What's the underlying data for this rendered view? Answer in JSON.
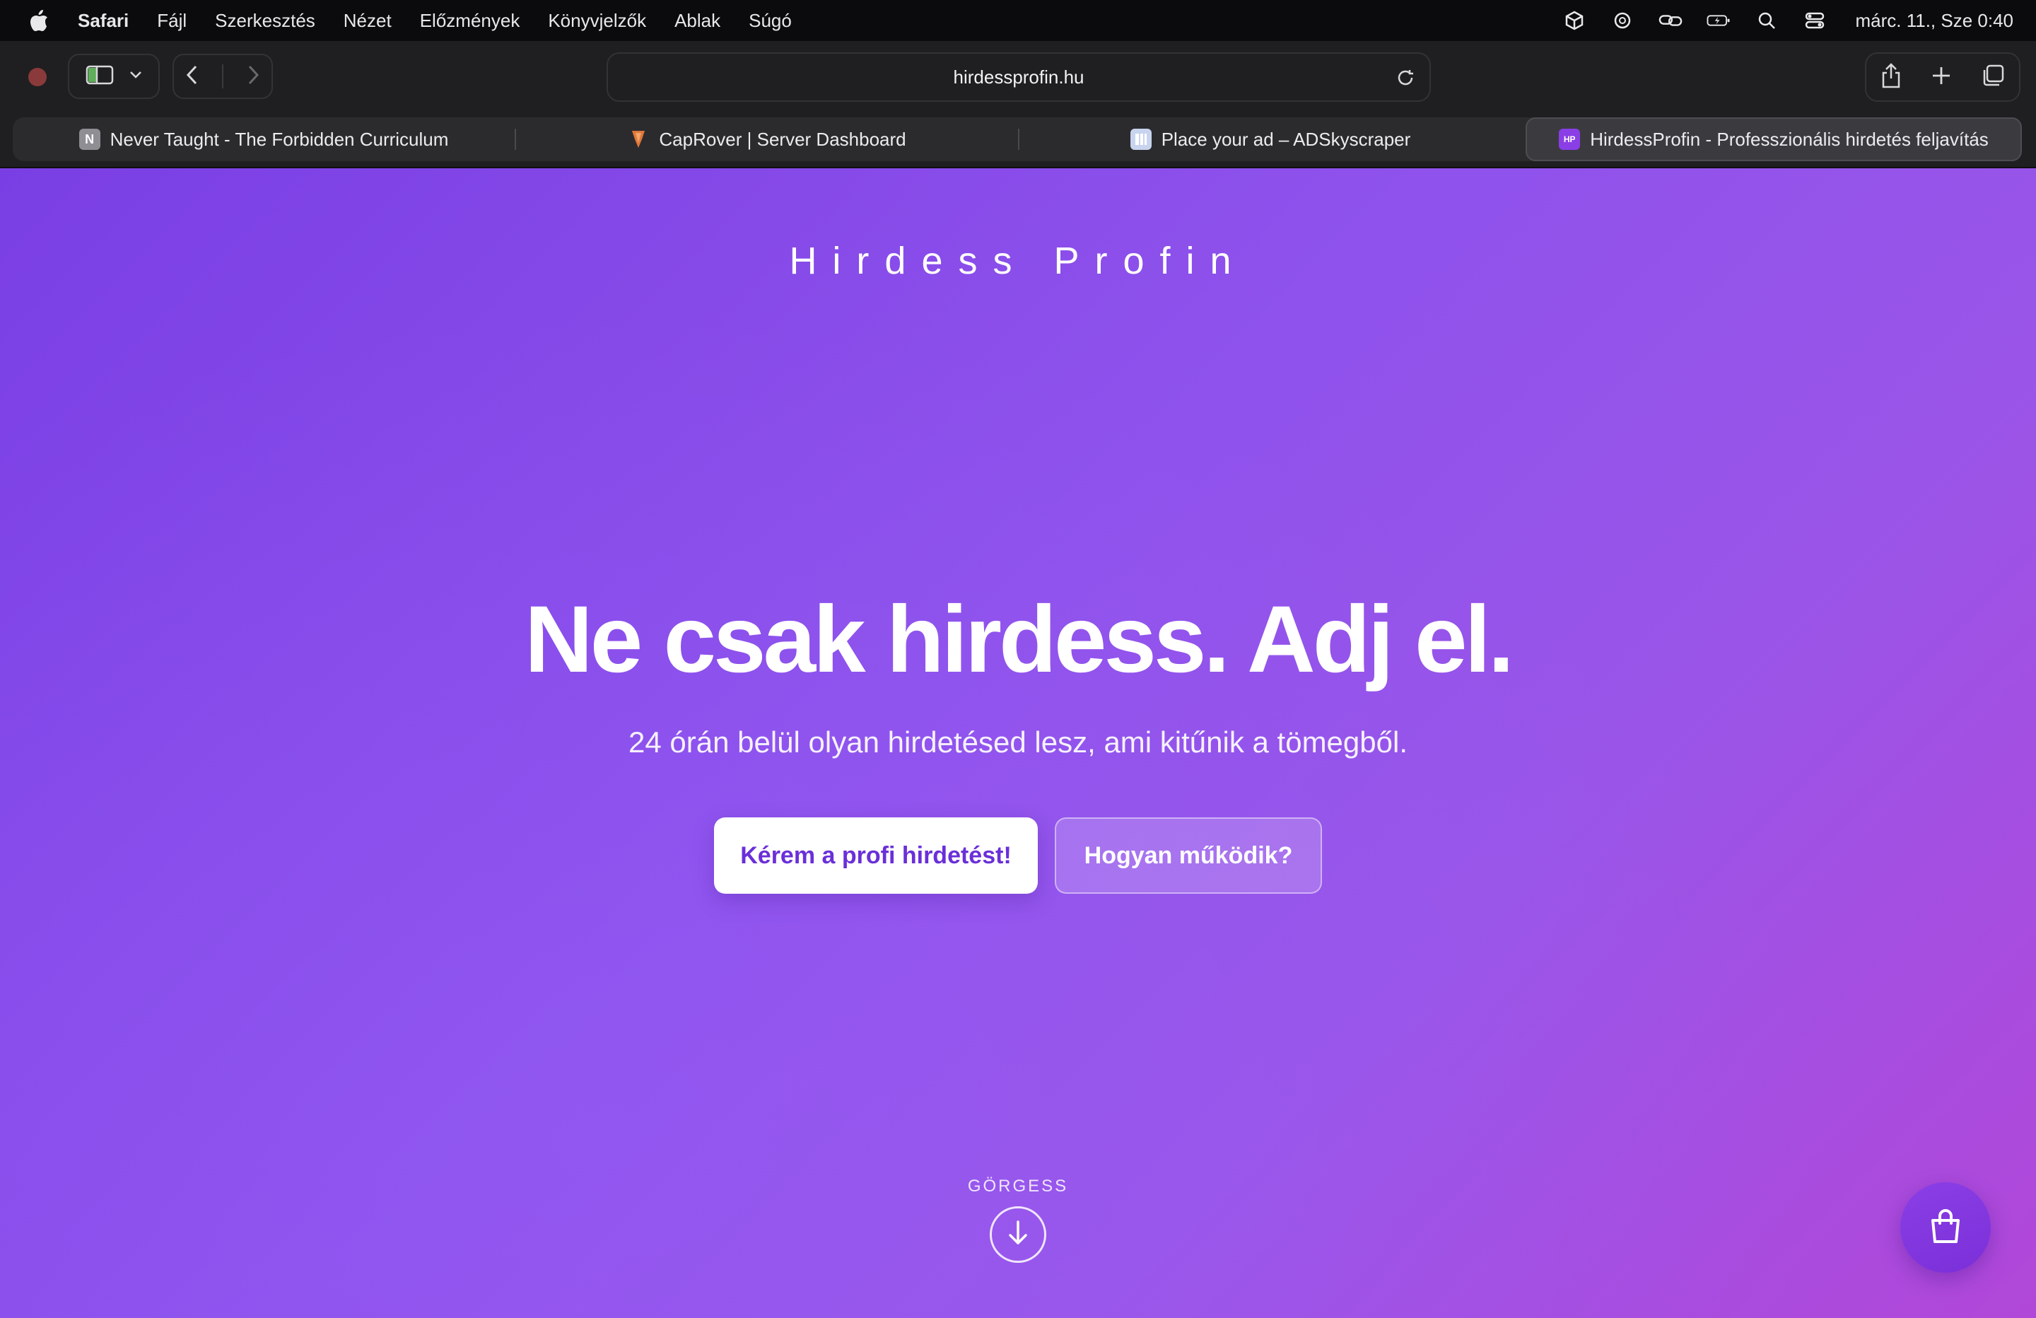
{
  "menubar": {
    "app_name": "Safari",
    "items": [
      "Fájl",
      "Szerkesztés",
      "Nézet",
      "Előzmények",
      "Könyvjelzők",
      "Ablak",
      "Súgó"
    ],
    "clock": "márc. 11., Sze  0:40"
  },
  "toolbar": {
    "url": "hirdessprofin.hu"
  },
  "tabs": [
    {
      "title": "Never Taught - The Forbidden Curriculum",
      "favicon": "N"
    },
    {
      "title": "CapRover | Server Dashboard",
      "favicon": ""
    },
    {
      "title": "Place your ad – ADSkyscraper",
      "favicon": ""
    },
    {
      "title": "HirdessProfin - Professzionális hirdetés feljavítás",
      "favicon": "HP"
    }
  ],
  "page": {
    "brand": "Hirdess Profin",
    "headline": "Ne csak hirdess. Adj el.",
    "subtitle": "24 órán belül olyan hirdetésed lesz, ami kitűnik a tömegből.",
    "cta_primary": "Kérem a profi hirdetést!",
    "cta_secondary": "Hogyan működik?",
    "scroll_label": "GÖRGESS"
  },
  "colors": {
    "gradient_start": "#7a3fe4",
    "gradient_end": "#b147d9",
    "primary_text": "#6a2fd9"
  }
}
